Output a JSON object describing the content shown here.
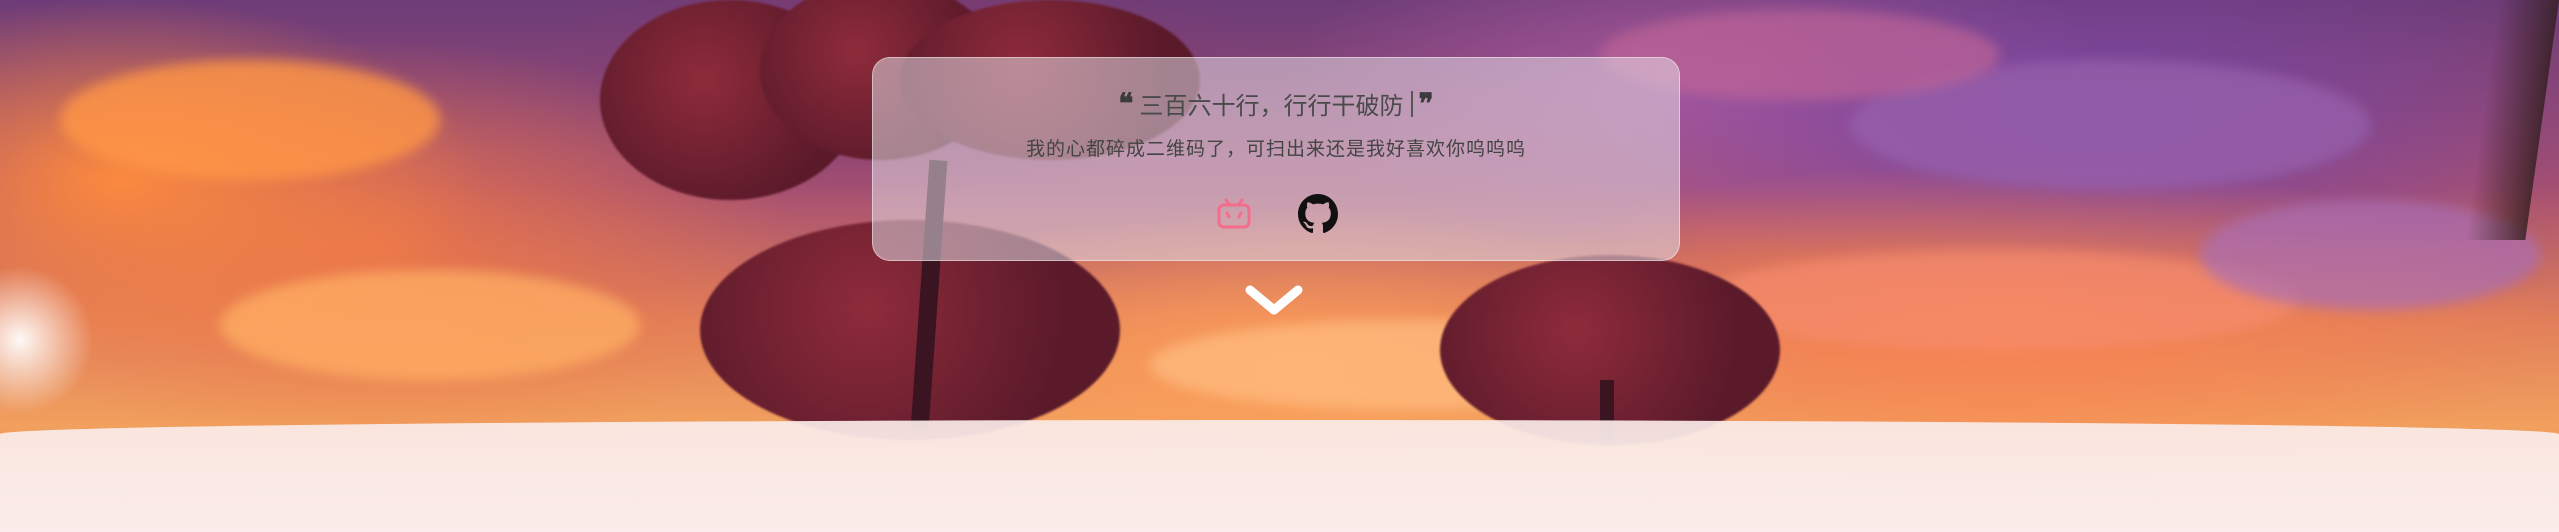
{
  "hero": {
    "quote_open": "❝",
    "quote_text": "三百六十行，行行干破防",
    "quote_close": "❞",
    "subtitle": "我的心都碎成二维码了，可扫出来还是我好喜欢你呜呜呜",
    "social": [
      {
        "name": "bilibili",
        "icon": "bilibili-icon",
        "color": "#f46d8c"
      },
      {
        "name": "github",
        "icon": "github-icon",
        "color": "#111111"
      }
    ]
  },
  "scroll": {
    "icon": "chevron-down-icon",
    "color": "#ffffff"
  },
  "colors": {
    "card_bg": "rgba(225,218,228,0.55)",
    "text": "#444444",
    "bilibili": "#f46d8c",
    "github": "#111111"
  }
}
